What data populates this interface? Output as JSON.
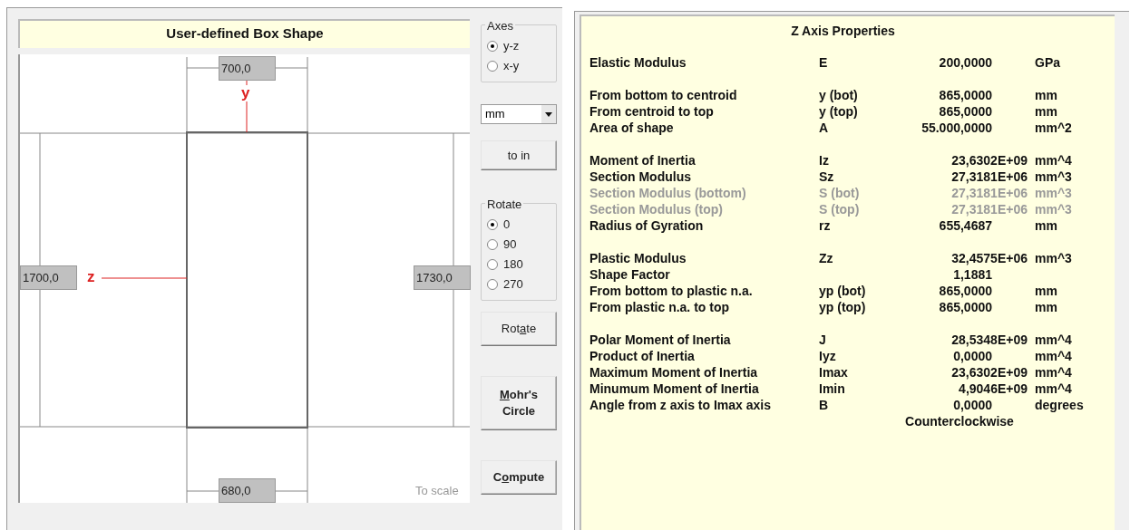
{
  "shape_panel": {
    "title": "User-defined Box Shape",
    "drawing": {
      "top_dimension": "700,0",
      "bottom_dimension": "680,0",
      "left_dimension": "1700,0",
      "right_dimension": "1730,0",
      "vertical_axis": "y",
      "horizontal_axis": "z",
      "scale_note": "To scale"
    }
  },
  "controls": {
    "axes": {
      "label": "Axes",
      "options": [
        {
          "label": "y-z",
          "selected": true
        },
        {
          "label": "x-y",
          "selected": false
        }
      ]
    },
    "units_select": {
      "value": "mm"
    },
    "convert_button": {
      "before": "to in",
      "bold": false
    },
    "rotate": {
      "label": "Rotate",
      "options": [
        {
          "label": "0",
          "selected": true
        },
        {
          "label": "90",
          "selected": false
        },
        {
          "label": "180",
          "selected": false
        },
        {
          "label": "270",
          "selected": false
        }
      ]
    },
    "buttons": [
      {
        "before": "Rot",
        "accel": "a",
        "after": "te",
        "bold": false
      },
      {
        "accel": "M",
        "after": "ohr's Circle",
        "bold": true
      },
      {
        "before": "C",
        "accel": "o",
        "after": "mpute",
        "bold": true
      }
    ]
  },
  "properties": {
    "title": "Z Axis Properties",
    "groups": [
      {
        "rows": [
          {
            "name": "Elastic Modulus",
            "symbol": "E",
            "value": "200,0000",
            "kind": "fixed",
            "unit": "GPa",
            "disabled": false
          }
        ]
      },
      {
        "rows": [
          {
            "name": "From bottom to centroid",
            "symbol": "y (bot)",
            "value": "865,0000",
            "kind": "fixed",
            "unit": "mm",
            "disabled": false
          },
          {
            "name": "From centroid to top",
            "symbol": "y (top)",
            "value": "865,0000",
            "kind": "fixed",
            "unit": "mm",
            "disabled": false
          },
          {
            "name": "Area of shape",
            "symbol": "A",
            "value": "55.000,0000",
            "kind": "fixed",
            "unit": "mm^2",
            "disabled": false
          }
        ]
      },
      {
        "rows": [
          {
            "name": "Moment of Inertia",
            "symbol": "Iz",
            "value": "23,6302E+09",
            "kind": "scientific",
            "unit": "mm^4",
            "disabled": false
          },
          {
            "name": "Section Modulus",
            "symbol": "Sz",
            "value": "27,3181E+06",
            "kind": "scientific",
            "unit": "mm^3",
            "disabled": false
          },
          {
            "name": "Section Modulus (bottom)",
            "symbol": "S (bot)",
            "value": "27,3181E+06",
            "kind": "scientific",
            "unit": "mm^3",
            "disabled": true
          },
          {
            "name": "Section Modulus (top)",
            "symbol": "S (top)",
            "value": "27,3181E+06",
            "kind": "scientific",
            "unit": "mm^3",
            "disabled": true
          },
          {
            "name": "Radius of Gyration",
            "symbol": "rz",
            "value": "655,4687",
            "kind": "fixed",
            "unit": "mm",
            "disabled": false
          }
        ]
      },
      {
        "rows": [
          {
            "name": "Plastic Modulus",
            "symbol": "Zz",
            "value": "32,4575E+06",
            "kind": "scientific",
            "unit": "mm^3",
            "disabled": false
          },
          {
            "name": "Shape Factor",
            "value": "1,1881",
            "kind": "fixed",
            "disabled": false
          },
          {
            "name": "From bottom to plastic n.a.",
            "symbol": "yp (bot)",
            "value": "865,0000",
            "kind": "fixed",
            "unit": "mm",
            "disabled": false
          },
          {
            "name": "From plastic n.a. to top",
            "symbol": "yp (top)",
            "value": "865,0000",
            "kind": "fixed",
            "unit": "mm",
            "disabled": false
          }
        ]
      },
      {
        "rows": [
          {
            "name": "Polar Moment of Inertia",
            "symbol": "J",
            "value": "28,5348E+09",
            "kind": "scientific",
            "unit": "mm^4",
            "disabled": false
          },
          {
            "name": "Product of Inertia",
            "symbol": "Iyz",
            "value": "0,0000",
            "kind": "fixed",
            "unit": "mm^4",
            "disabled": false
          },
          {
            "name": "Maximum Moment of Inertia",
            "symbol": "Imax",
            "value": "23,6302E+09",
            "kind": "scientific",
            "unit": "mm^4",
            "disabled": false
          },
          {
            "name": "Minumum Moment of Inertia",
            "symbol": "Imin",
            "value": "4,9046E+09",
            "kind": "scientific",
            "unit": "mm^4",
            "disabled": false
          },
          {
            "name": "Angle from z axis to Imax axis",
            "symbol": "B",
            "value": "0,0000",
            "kind": "fixed",
            "unit": "degrees",
            "disabled": false
          }
        ]
      }
    ],
    "note": "Counterclockwise"
  }
}
